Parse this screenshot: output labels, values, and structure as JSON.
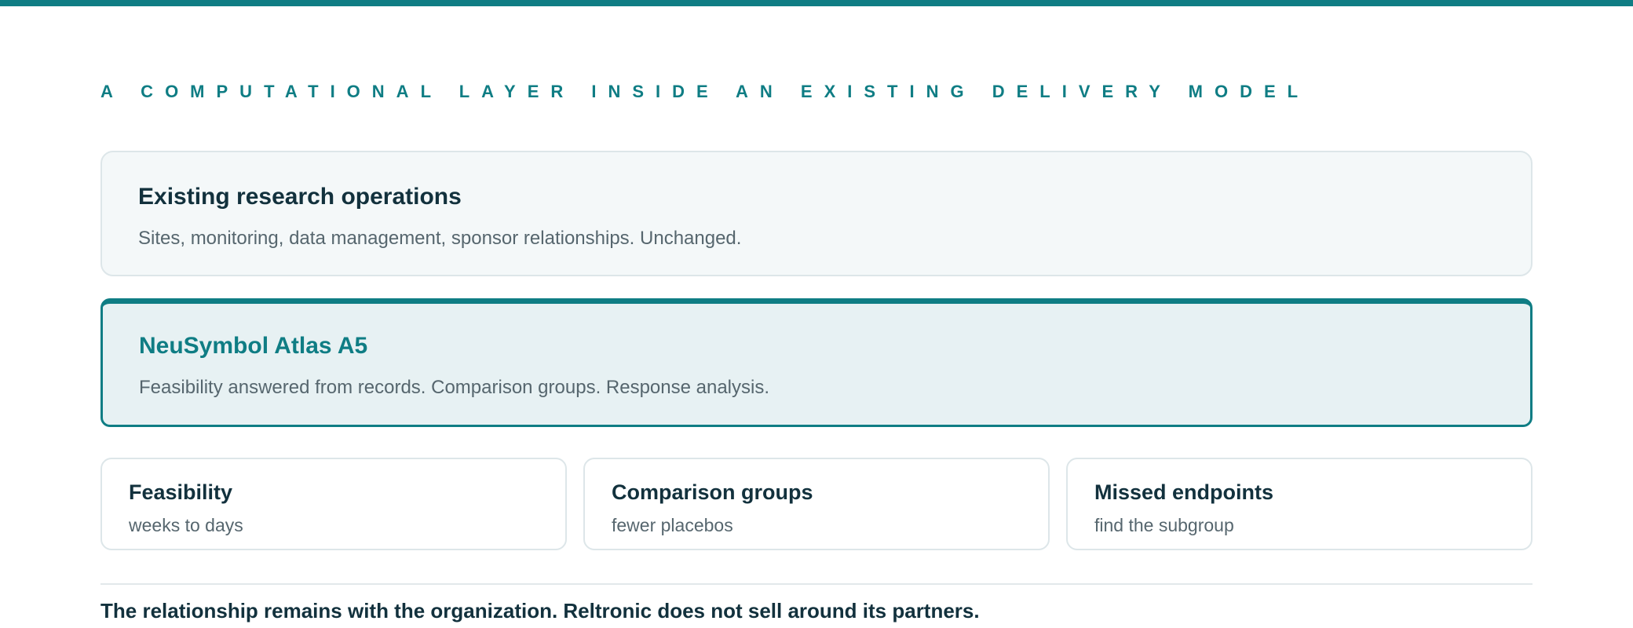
{
  "eyebrow": "A COMPUTATIONAL LAYER INSIDE AN EXISTING DELIVERY MODEL",
  "existing": {
    "title": "Existing research operations",
    "description": "Sites, monitoring, data management, sponsor relationships. Unchanged."
  },
  "atlas": {
    "title": "NeuSymbol Atlas A5",
    "description": "Feasibility answered from records. Comparison groups. Response analysis."
  },
  "benefits": [
    {
      "title": "Feasibility",
      "subtitle": "weeks to days"
    },
    {
      "title": "Comparison groups",
      "subtitle": "fewer placebos"
    },
    {
      "title": "Missed endpoints",
      "subtitle": "find the subgroup"
    }
  ],
  "footer_note": "The relationship remains with the organization. Reltronic does not sell around its partners.",
  "colors": {
    "accent": "#0f7d84",
    "text": "#12313d",
    "muted": "#56666e",
    "atlas_bg": "#e7f1f3",
    "existing_bg": "#f4f8f9"
  }
}
